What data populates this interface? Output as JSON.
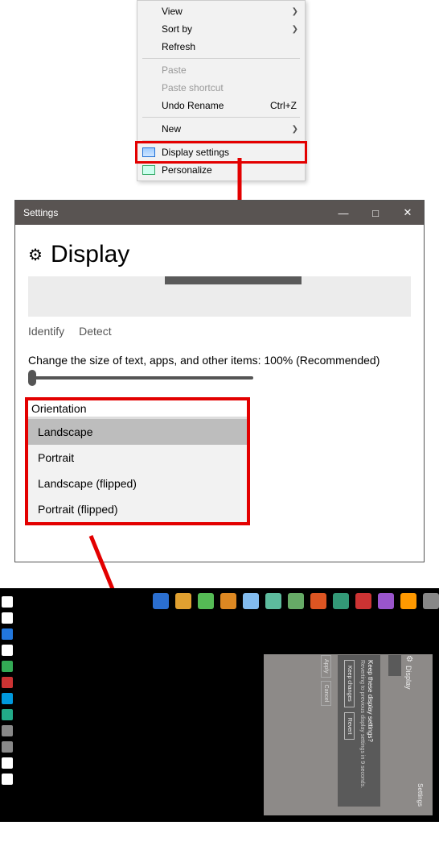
{
  "contextMenu": {
    "items": [
      {
        "label": "View",
        "submenu": true
      },
      {
        "label": "Sort by",
        "submenu": true
      },
      {
        "label": "Refresh"
      }
    ],
    "secondGroup": [
      {
        "label": "Paste",
        "disabled": true
      },
      {
        "label": "Paste shortcut",
        "disabled": true
      },
      {
        "label": "Undo Rename",
        "shortcut": "Ctrl+Z"
      }
    ],
    "thirdGroup": [
      {
        "label": "New",
        "submenu": true
      }
    ],
    "fourthGroup": [
      {
        "label": "Display settings",
        "highlighted": true,
        "icon": "display"
      },
      {
        "label": "Personalize",
        "icon": "personalize"
      }
    ]
  },
  "settingsWindow": {
    "title": "Settings",
    "heading": "Display",
    "identify": "Identify",
    "detect": "Detect",
    "resizeLabel": "Change the size of text, apps, and other items: 100% (Recommended)",
    "orientationLabel": "Orientation",
    "orientationOptions": [
      "Landscape",
      "Portrait",
      "Landscape (flipped)",
      "Portrait (flipped)"
    ]
  },
  "rotatedDialog": {
    "winTitle": "Settings",
    "heading": "Display",
    "question": "Keep these display settings?",
    "sub": "Reverting to previous display settings in 9 seconds.",
    "keep": "Keep changes",
    "revert": "Revert",
    "apply": "Apply",
    "cancel": "Cancel"
  },
  "colors": {
    "highlight": "#e30000",
    "titlebar": "#595452"
  },
  "taskbarIconColors": [
    "#2b6fd0",
    "#e0a030",
    "#55bb55",
    "#dd8822",
    "#82bbee",
    "#5dbb9d",
    "#66aa66",
    "#dd5522",
    "#339977",
    "#cc3333",
    "#9955cc",
    "#ff9900",
    "#888888"
  ],
  "sidebarIconColors": [
    "#ffffff",
    "#ffffff",
    "#2277dd",
    "#ffffff",
    "#33aa55",
    "#cc3333",
    "#0099dd",
    "#22aa88",
    "#888888",
    "#888888",
    "#ffffff",
    "#ffffff"
  ]
}
